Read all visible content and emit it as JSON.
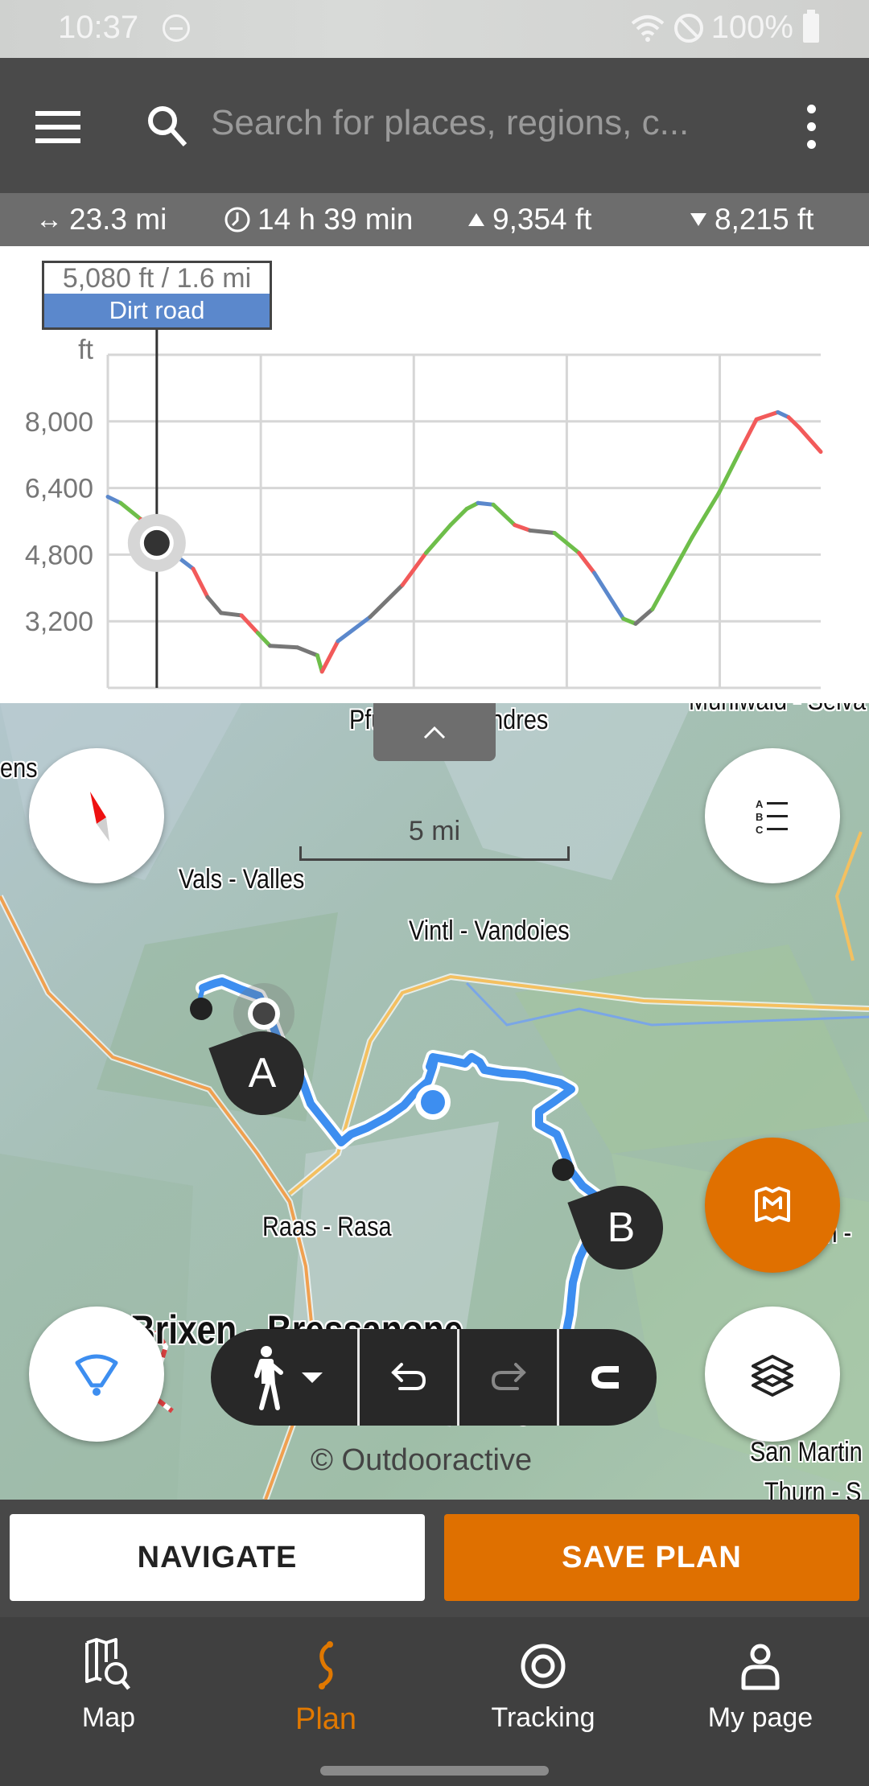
{
  "status_bar": {
    "time": "10:37",
    "battery": "100%",
    "icons": [
      "dnd-icon",
      "wifi-icon",
      "no-sim-icon",
      "battery-icon"
    ]
  },
  "app_bar": {
    "menu_icon": "hamburger-icon",
    "search_placeholder": "Search for places, regions, c...",
    "more_icon": "kebab-icon"
  },
  "stats": {
    "distance": "23.3 mi",
    "duration": "14 h 39 min",
    "ascent": "9,354 ft",
    "descent": "8,215 ft"
  },
  "elevation_tooltip": {
    "value": "5,080 ft / 1.6 mi",
    "surface": "Dirt road",
    "surface_color": "#5b88cc"
  },
  "chart_data": {
    "type": "line",
    "title": "",
    "xlabel": "",
    "ylabel": "ft",
    "ylim": [
      1600,
      9600
    ],
    "xlim": [
      0,
      23.3
    ],
    "yticks": [
      3200,
      4800,
      6400,
      8000
    ],
    "ytick_labels": [
      "3,200",
      "4,800",
      "6,400",
      "8,000"
    ],
    "x_gridlines": [
      0,
      5,
      10,
      15,
      20
    ],
    "grid": true,
    "legend": "none",
    "cursor": {
      "x": 1.6,
      "y": 5080
    },
    "surface_colors": {
      "dirt_road": "#5b88cc",
      "path": "#6ebe4a",
      "road": "#f25a5a",
      "unknown": "#777777"
    },
    "series": [
      {
        "name": "elevation",
        "x": [
          0,
          0.42,
          1.08,
          1.63,
          2.79,
          3.26,
          3.7,
          4.37,
          4.9,
          5.3,
          6.2,
          6.85,
          7.0,
          7.52,
          8.57,
          9.63,
          10.4,
          11.2,
          11.73,
          12.1,
          12.6,
          13.3,
          13.8,
          14.6,
          15.4,
          15.9,
          16.85,
          17.25,
          17.8,
          19.1,
          19.97,
          20.7,
          21.2,
          21.9,
          22.25,
          22.6,
          23.3
        ],
        "y": [
          6190,
          6040,
          5650,
          5110,
          4460,
          3780,
          3400,
          3340,
          2920,
          2610,
          2570,
          2380,
          1990,
          2720,
          3300,
          4070,
          4840,
          5510,
          5900,
          6040,
          6000,
          5510,
          5380,
          5320,
          4840,
          4360,
          3260,
          3140,
          3490,
          5220,
          6280,
          7340,
          8050,
          8220,
          8100,
          7850,
          7270
        ],
        "segment_colors": [
          "#5b88cc",
          "#6ebe4a",
          "#f25a5a",
          "#5b88cc",
          "#f25a5a",
          "#777777",
          "#777777",
          "#f25a5a",
          "#6ebe4a",
          "#777777",
          "#777777",
          "#6ebe4a",
          "#f25a5a",
          "#5b88cc",
          "#777777",
          "#f25a5a",
          "#6ebe4a",
          "#6ebe4a",
          "#6ebe4a",
          "#5b88cc",
          "#6ebe4a",
          "#f25a5a",
          "#777777",
          "#6ebe4a",
          "#f25a5a",
          "#5b88cc",
          "#6ebe4a",
          "#777777",
          "#6ebe4a",
          "#6ebe4a",
          "#6ebe4a",
          "#f25a5a",
          "#f25a5a",
          "#5b88cc",
          "#f25a5a",
          "#f25a5a"
        ]
      }
    ]
  },
  "map": {
    "collapse_icon": "chevron-up-icon",
    "scale_label": "5 mi",
    "labels": [
      "Pfunders - Fundres",
      "ens",
      "Vals - Valles",
      "Vintl - Vandoies",
      "Raas - Rasa",
      "Brixen - Bressanone",
      "San Martin",
      "Thurn - S",
      "ch -",
      "Mühlwald - Selva"
    ],
    "waypoints": [
      "A",
      "B"
    ],
    "attribution": "© Outdooractive",
    "route_color": "#3d8ef0",
    "fabs": [
      "compass-icon",
      "waypoint-list-icon",
      "location-cone-icon",
      "map-plan-icon",
      "layers-icon"
    ],
    "toolbar": [
      "hiking-mode-icon",
      "undo-icon",
      "redo-icon",
      "magnet-snap-icon"
    ]
  },
  "actions": {
    "navigate": "NAVIGATE",
    "save_plan": "SAVE PLAN"
  },
  "bottom_nav": [
    {
      "label": "Map",
      "icon": "map-search-icon",
      "active": false
    },
    {
      "label": "Plan",
      "icon": "route-plan-icon",
      "active": true
    },
    {
      "label": "Tracking",
      "icon": "tracking-target-icon",
      "active": false
    },
    {
      "label": "My page",
      "icon": "user-icon",
      "active": false
    }
  ],
  "colors": {
    "accent": "#e07000",
    "app_bar": "#4a4a4a",
    "stats_bar": "#6d6d6d",
    "nav_bar": "#404040"
  }
}
